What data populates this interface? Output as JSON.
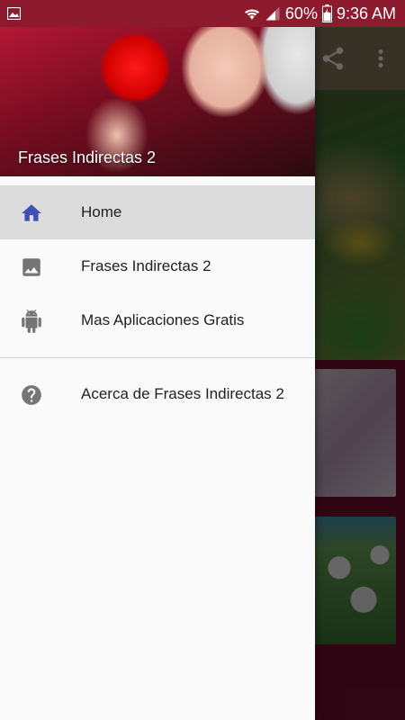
{
  "status_bar": {
    "battery_percent": "60%",
    "time": "9:36 AM",
    "icons": [
      "gallery-notification-icon",
      "wifi-icon",
      "signal-icon",
      "battery-charging-icon"
    ]
  },
  "toolbar": {
    "icons": [
      "share-icon",
      "more-vert-icon"
    ]
  },
  "drawer": {
    "header_title": "Frases Indirectas 2",
    "items": [
      {
        "label": "Home",
        "icon": "home-icon",
        "selected": true
      },
      {
        "label": "Frases Indirectas 2",
        "icon": "image-icon",
        "selected": false
      },
      {
        "label": "Mas Aplicaciones Gratis",
        "icon": "android-icon",
        "selected": false
      }
    ],
    "secondary_items": [
      {
        "label": "Acerca de Frases Indirectas 2",
        "icon": "help-icon",
        "selected": false
      }
    ]
  },
  "colors": {
    "accent": "#3f51b5",
    "icon_gray": "#757575",
    "status_bar": "#8e1a2e",
    "selected_row": "#dcdcdc"
  }
}
